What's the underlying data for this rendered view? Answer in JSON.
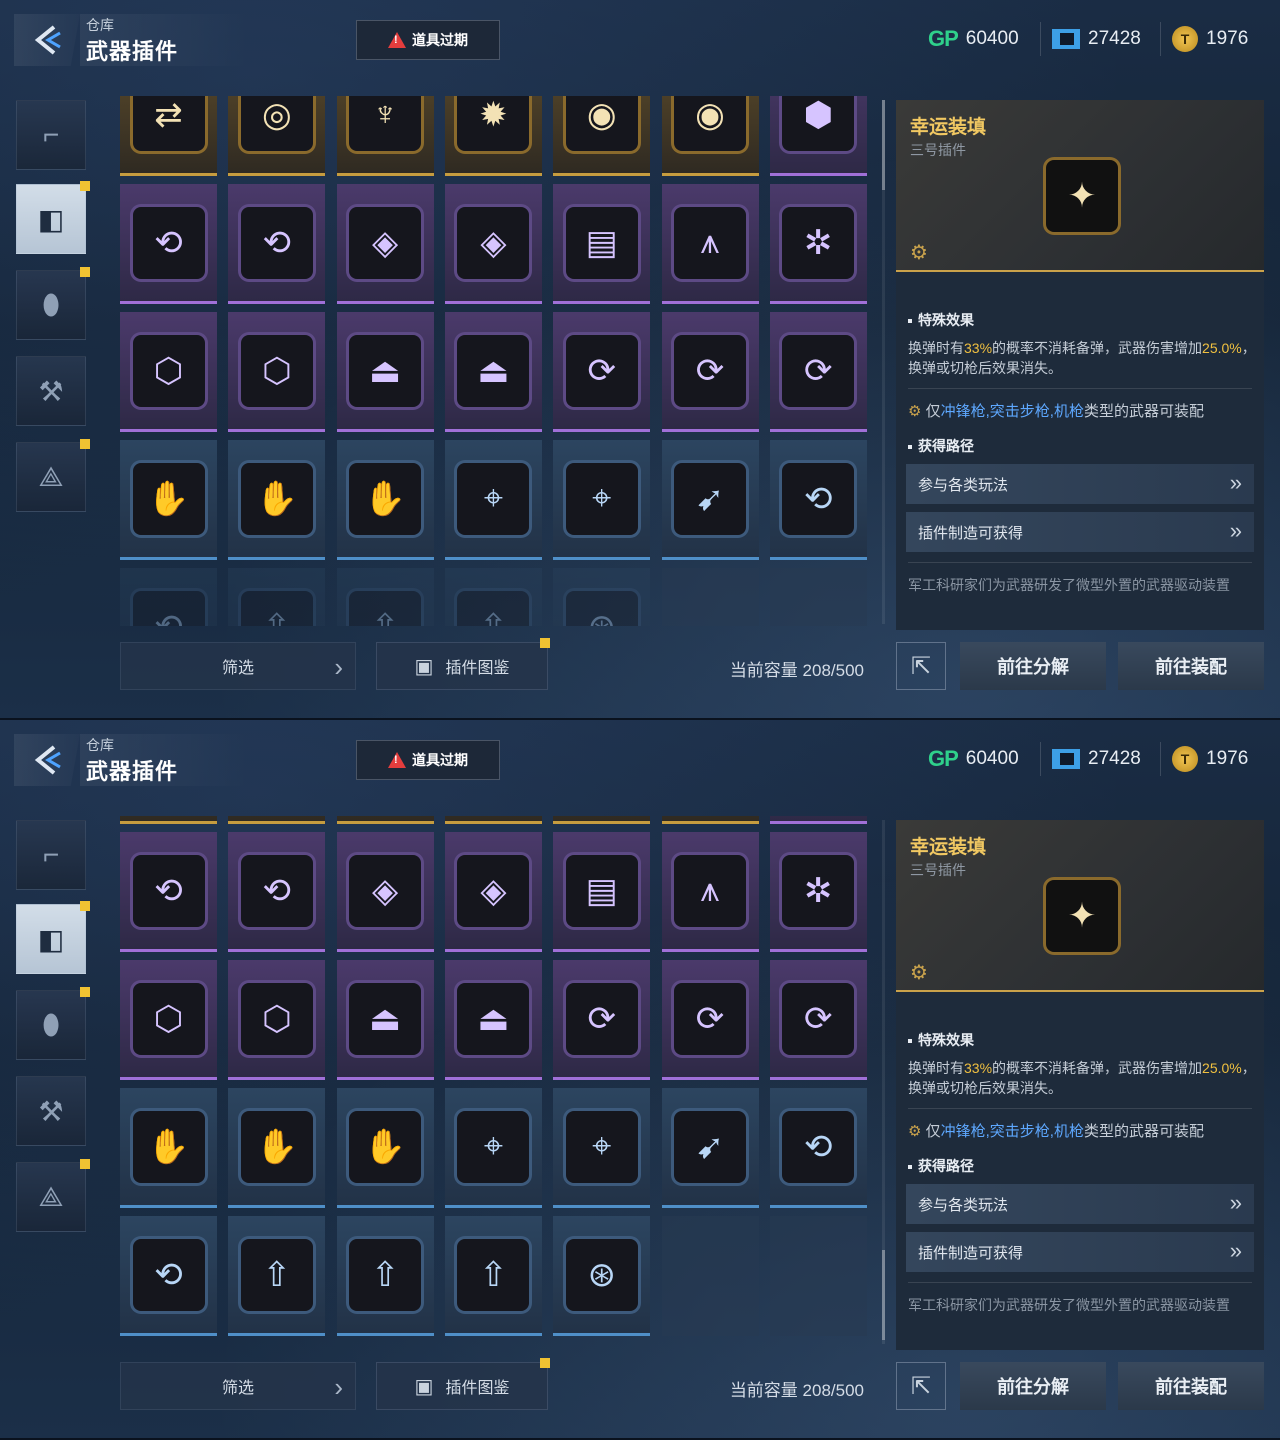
{
  "header": {
    "breadcrumb": "仓库",
    "title": "武器插件",
    "expire_label": "道具过期"
  },
  "currency": {
    "gp_label": "GP",
    "gp_value": "60400",
    "ticket_value": "27428",
    "coin_value": "1976"
  },
  "side_tabs": [
    {
      "icon": "pistol-icon",
      "active": false,
      "badge": false
    },
    {
      "icon": "plugin-icon",
      "active": true,
      "badge": true
    },
    {
      "icon": "grenade-icon",
      "active": false,
      "badge": true
    },
    {
      "icon": "weapon-mod-icon",
      "active": false,
      "badge": false
    },
    {
      "icon": "blueprint-icon",
      "active": false,
      "badge": true
    }
  ],
  "grid_top": [
    [
      {
        "rarity": "gold",
        "glyph": "⇄"
      },
      {
        "rarity": "gold",
        "glyph": "◎"
      },
      {
        "rarity": "gold",
        "glyph": "♆"
      },
      {
        "rarity": "gold",
        "glyph": "✹"
      },
      {
        "rarity": "gold",
        "glyph": "◉"
      },
      {
        "rarity": "gold",
        "glyph": "◉"
      },
      {
        "rarity": "purple",
        "glyph": "⬢"
      }
    ],
    [
      {
        "rarity": "purple",
        "glyph": "⟲"
      },
      {
        "rarity": "purple",
        "glyph": "⟲"
      },
      {
        "rarity": "purple",
        "glyph": "◈"
      },
      {
        "rarity": "purple",
        "glyph": "◈"
      },
      {
        "rarity": "purple",
        "glyph": "▤"
      },
      {
        "rarity": "purple",
        "glyph": "⩚"
      },
      {
        "rarity": "purple",
        "glyph": "✲"
      }
    ],
    [
      {
        "rarity": "purple",
        "glyph": "⬡"
      },
      {
        "rarity": "purple",
        "glyph": "⬡"
      },
      {
        "rarity": "purple",
        "glyph": "⏏"
      },
      {
        "rarity": "purple",
        "glyph": "⏏"
      },
      {
        "rarity": "purple",
        "glyph": "⟳"
      },
      {
        "rarity": "purple",
        "glyph": "⟳"
      },
      {
        "rarity": "purple",
        "glyph": "⟳"
      }
    ],
    [
      {
        "rarity": "blue",
        "glyph": "✋"
      },
      {
        "rarity": "blue",
        "glyph": "✋"
      },
      {
        "rarity": "blue",
        "glyph": "✋"
      },
      {
        "rarity": "blue",
        "glyph": "⌖"
      },
      {
        "rarity": "blue",
        "glyph": "⌖"
      },
      {
        "rarity": "blue",
        "glyph": "➹"
      },
      {
        "rarity": "blue",
        "glyph": "⟲"
      }
    ],
    [
      {
        "rarity": "blue",
        "glyph": "⟲",
        "faded": true
      },
      {
        "rarity": "blue",
        "glyph": "⇧",
        "faded": true
      },
      {
        "rarity": "blue",
        "glyph": "⇧",
        "faded": true
      },
      {
        "rarity": "blue",
        "glyph": "⇧",
        "faded": true
      },
      {
        "rarity": "blue",
        "glyph": "⊛",
        "faded": true
      },
      {
        "rarity": "empty"
      },
      {
        "rarity": "empty"
      }
    ]
  ],
  "grid_bottom": [
    [
      {
        "rarity": "purple",
        "glyph": "⟲"
      },
      {
        "rarity": "purple",
        "glyph": "⟲"
      },
      {
        "rarity": "purple",
        "glyph": "◈"
      },
      {
        "rarity": "purple",
        "glyph": "◈"
      },
      {
        "rarity": "purple",
        "glyph": "▤"
      },
      {
        "rarity": "purple",
        "glyph": "⩚"
      },
      {
        "rarity": "purple",
        "glyph": "✲"
      }
    ],
    [
      {
        "rarity": "purple",
        "glyph": "⬡"
      },
      {
        "rarity": "purple",
        "glyph": "⬡"
      },
      {
        "rarity": "purple",
        "glyph": "⏏"
      },
      {
        "rarity": "purple",
        "glyph": "⏏"
      },
      {
        "rarity": "purple",
        "glyph": "⟳"
      },
      {
        "rarity": "purple",
        "glyph": "⟳"
      },
      {
        "rarity": "purple",
        "glyph": "⟳"
      }
    ],
    [
      {
        "rarity": "blue",
        "glyph": "✋"
      },
      {
        "rarity": "blue",
        "glyph": "✋"
      },
      {
        "rarity": "blue",
        "glyph": "✋"
      },
      {
        "rarity": "blue",
        "glyph": "⌖"
      },
      {
        "rarity": "blue",
        "glyph": "⌖"
      },
      {
        "rarity": "blue",
        "glyph": "➹"
      },
      {
        "rarity": "blue",
        "glyph": "⟲"
      }
    ],
    [
      {
        "rarity": "blue",
        "glyph": "⟲"
      },
      {
        "rarity": "blue",
        "glyph": "⇧"
      },
      {
        "rarity": "blue",
        "glyph": "⇧"
      },
      {
        "rarity": "blue",
        "glyph": "⇧"
      },
      {
        "rarity": "blue",
        "glyph": "⊛"
      },
      {
        "rarity": "empty"
      },
      {
        "rarity": "empty"
      }
    ]
  ],
  "bottom_bar": {
    "filter_label": "筛选",
    "catalog_label": "插件图鉴",
    "capacity_text": "当前容量 208/500"
  },
  "detail": {
    "name": "幸运装填",
    "subtitle": "三号插件",
    "effect_title": "特殊效果",
    "effect_part1": "换弹时有",
    "effect_pct": "33%",
    "effect_part2": "的概率不消耗备弹，武器伤害增加",
    "effect_dmg": "25.0%",
    "effect_part3": "，换弹或切枪后效果消失。",
    "equip_prefix": "仅",
    "equip_types": "冲锋枪,突击步枪,机枪",
    "equip_suffix": "类型的武器可装配",
    "route_title": "获得路径",
    "route_1": "参与各类玩法",
    "route_2": "插件制造可获得",
    "lore": "军工科研家们为武器研发了微型外置的武器驱动装置"
  },
  "actions": {
    "decompose": "前往分解",
    "equip": "前往装配"
  },
  "colors": {
    "gold_name": "#f1c862",
    "highlight": "#f0c040",
    "weapon_types": "#5ea8ff",
    "warning": "#e43d3d",
    "gp": "#2fd08b"
  }
}
